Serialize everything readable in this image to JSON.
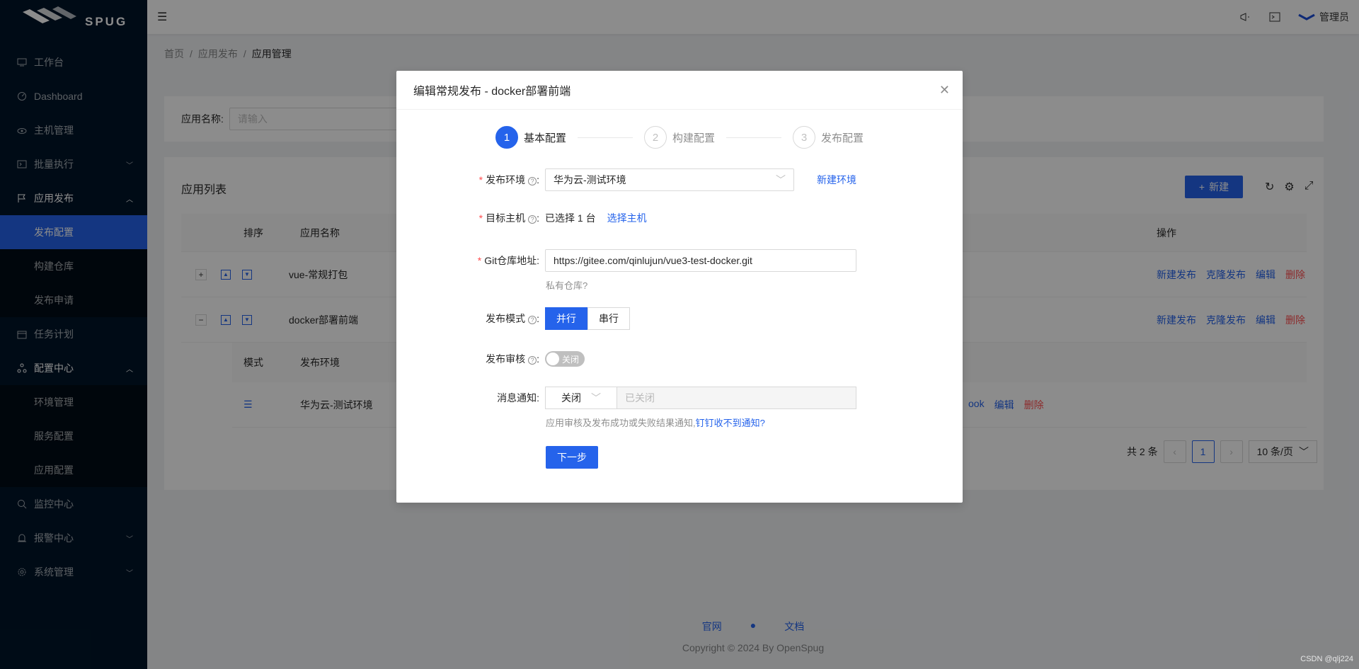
{
  "brand": {
    "logo_text": "SPUG"
  },
  "sidebar": {
    "items": [
      {
        "label": "工作台",
        "icon": "desktop-icon"
      },
      {
        "label": "Dashboard",
        "icon": "dashboard-icon"
      },
      {
        "label": "主机管理",
        "icon": "cloud-server-icon"
      },
      {
        "label": "批量执行",
        "icon": "terminal-icon"
      },
      {
        "label": "应用发布",
        "icon": "flag-icon"
      },
      {
        "label": "任务计划",
        "icon": "calendar-icon"
      },
      {
        "label": "配置中心",
        "icon": "deployment-icon"
      },
      {
        "label": "监控中心",
        "icon": "monitor-icon"
      },
      {
        "label": "报警中心",
        "icon": "alert-icon"
      },
      {
        "label": "系统管理",
        "icon": "setting-icon"
      }
    ],
    "sub_deploy": [
      "发布配置",
      "构建仓库",
      "发布申请"
    ],
    "sub_config": [
      "环境管理",
      "服务配置",
      "应用配置"
    ]
  },
  "header": {
    "user": "管理员"
  },
  "breadcrumb": [
    "首页",
    "应用发布",
    "应用管理"
  ],
  "search": {
    "label": "应用名称:",
    "placeholder": "请输入"
  },
  "list": {
    "title": "应用列表",
    "new_label": "新建",
    "columns": {
      "sort": "排序",
      "name": "应用名称",
      "ops": "操作"
    },
    "rows": [
      {
        "expand": "+",
        "name": "vue-常规打包"
      },
      {
        "expand": "−",
        "name": "docker部署前端"
      }
    ],
    "ops": [
      "新建发布",
      "克隆发布",
      "编辑",
      "删除"
    ],
    "sub_columns": {
      "mode": "模式",
      "env": "发布环境"
    },
    "sub_row": {
      "env": "华为云-测试环境",
      "ops_partial": "ook",
      "edit": "编辑",
      "delete": "删除"
    },
    "pager": {
      "total": "共 2 条",
      "page": "1",
      "size": "10 条/页"
    }
  },
  "footer": {
    "links": [
      "官网",
      "文档"
    ],
    "copyright": "Copyright © 2024 By OpenSpug"
  },
  "watermark": "CSDN @qlj224",
  "modal": {
    "title": "编辑常规发布 - docker部署前端",
    "steps": [
      {
        "num": "1",
        "title": "基本配置"
      },
      {
        "num": "2",
        "title": "构建配置"
      },
      {
        "num": "3",
        "title": "发布配置"
      }
    ],
    "env_label": "发布环境",
    "env_value": "华为云-测试环境",
    "env_new": "新建环境",
    "host_label": "目标主机",
    "host_value": "已选择 1 台",
    "host_select": "选择主机",
    "git_label": "Git仓库地址:",
    "git_value": "https://gitee.com/qinlujun/vue3-test-docker.git",
    "git_private": "私有仓库?",
    "mode_label": "发布模式",
    "mode_options": [
      "并行",
      "串行"
    ],
    "audit_label": "发布审核",
    "audit_value": "关闭",
    "notify_label": "消息通知:",
    "notify_select": "关闭",
    "notify_placeholder": "已关闭",
    "notify_help": "应用审核及发布成功或失败结果通知,",
    "notify_help_link": "钉钉收不到通知?",
    "next_label": "下一步"
  },
  "colors": {
    "primary": "#2563eb",
    "sidebar": "#001529",
    "danger": "#ff4d4f"
  }
}
